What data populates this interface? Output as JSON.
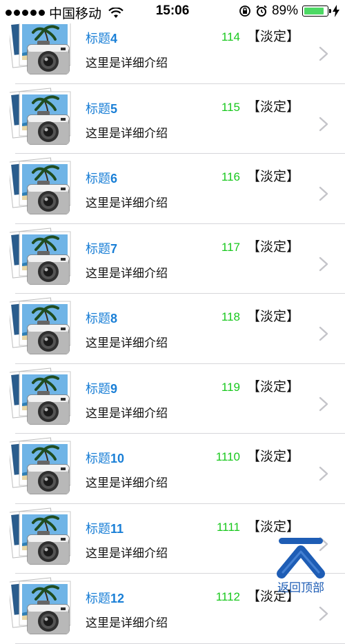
{
  "status_bar": {
    "carrier": "中国移动",
    "time": "15:06",
    "battery_percent": "89%",
    "battery_level": 0.89,
    "signal_bars": 5
  },
  "rows": [
    {
      "title_prefix": "标题",
      "title_num": "4",
      "detail": "这里是详细介绍",
      "count": "114",
      "tag": "【淡定】"
    },
    {
      "title_prefix": "标题",
      "title_num": "5",
      "detail": "这里是详细介绍",
      "count": "115",
      "tag": "【淡定】"
    },
    {
      "title_prefix": "标题",
      "title_num": "6",
      "detail": "这里是详细介绍",
      "count": "116",
      "tag": "【淡定】"
    },
    {
      "title_prefix": "标题",
      "title_num": "7",
      "detail": "这里是详细介绍",
      "count": "117",
      "tag": "【淡定】"
    },
    {
      "title_prefix": "标题",
      "title_num": "8",
      "detail": "这里是详细介绍",
      "count": "118",
      "tag": "【淡定】"
    },
    {
      "title_prefix": "标题",
      "title_num": "9",
      "detail": "这里是详细介绍",
      "count": "119",
      "tag": "【淡定】"
    },
    {
      "title_prefix": "标题",
      "title_num": "10",
      "detail": "这里是详细介绍",
      "count": "1110",
      "tag": "【淡定】"
    },
    {
      "title_prefix": "标题",
      "title_num": "11",
      "detail": "这里是详细介绍",
      "count": "1111",
      "tag": "【淡定】"
    },
    {
      "title_prefix": "标题",
      "title_num": "12",
      "detail": "这里是详细介绍",
      "count": "1112",
      "tag": "【淡定】"
    }
  ],
  "back_to_top": {
    "label": "返回顶部",
    "icon": "chevron-up-icon"
  },
  "colors": {
    "title": "#1a7fd6",
    "count": "#19c81e",
    "battery": "#4cd964",
    "back_to_top": "#1e5db5"
  }
}
